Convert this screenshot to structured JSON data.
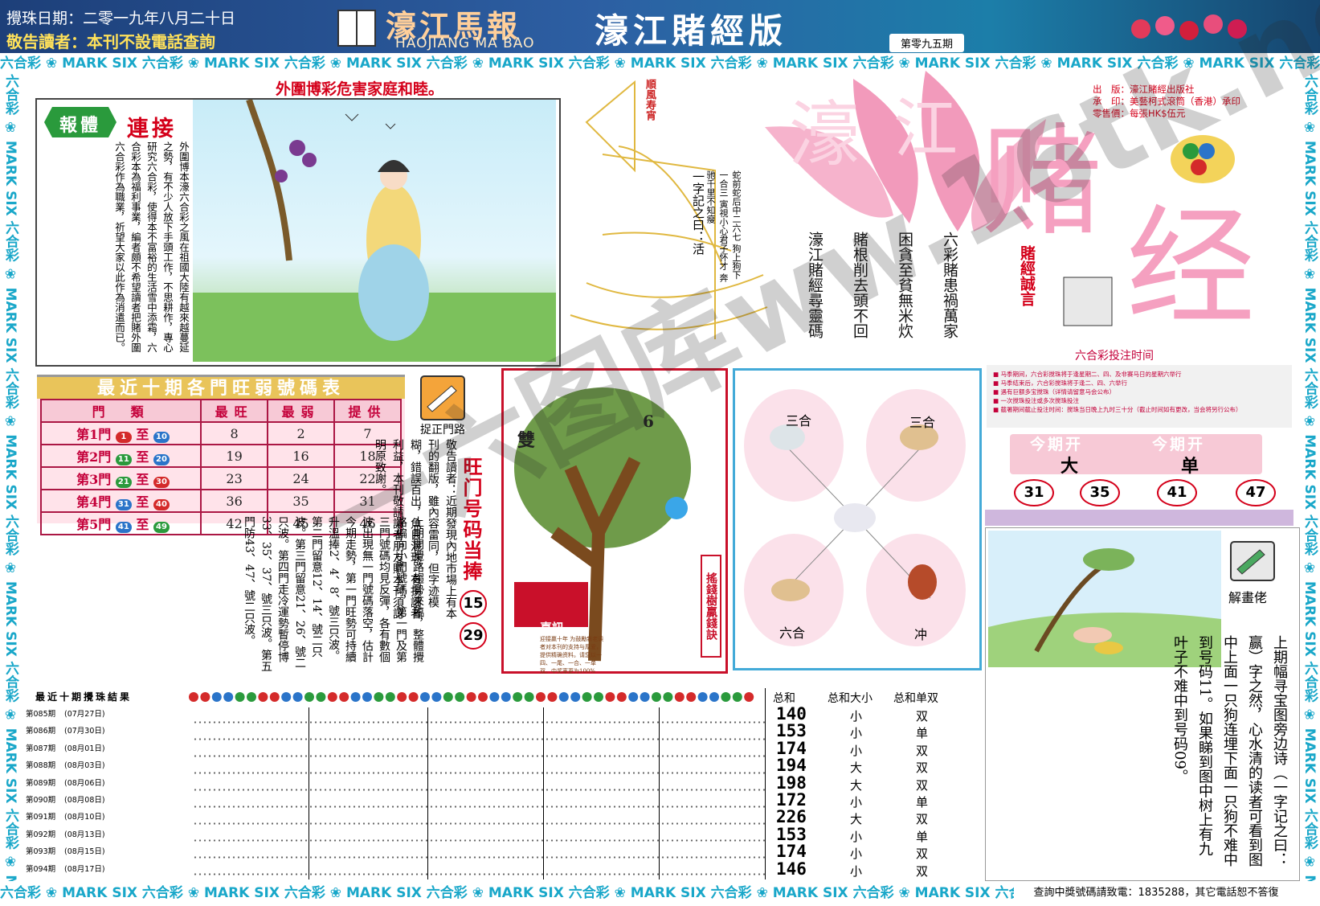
{
  "header": {
    "date_line": "攪珠日期：二零一九年八月二十日",
    "warning": "敬告讀者：本刊不設電話查詢",
    "paper_name": "濠江馬報",
    "paper_roman": "HAOJIANG MA BAO",
    "edition_title": "濠江賭經版",
    "issue": "第零九五期"
  },
  "border_strip": "六合彩 ❀ MARK SIX 六合彩 ❀ MARK SIX 六合彩 ❀ MARK SIX 六合彩 ❀ MARK SIX 六合彩 ❀ MARK SIX 六合彩 ❀ MARK SIX 六合彩 ❀ MARK SIX 六合彩 ❀ MARK SIX 六合彩 ❀ MARK SIX 六合彩 ❀ MARK SIX",
  "hotline": "查詢中獎號碼請致電：1835288，其它電話恕不答復",
  "story": {
    "title": "外圍博彩危害家庭和睦。",
    "badge": "報體",
    "serial": "連接",
    "text": "外圍博本濠六合彩之風在祖國大陸有越來越蔓延之勢，有不少人放下手頭工作，不思耕作，專心研究六合彩，使得本不富裕的生活雪中添霜，六合彩本為福利事業，編者頗不希望讀者把賭外圍六合彩作為職業，祈望大家以此作為消遣而已。"
  },
  "sail": {
    "label": "順風寿宵",
    "couplet_title": "一字記之曰：活",
    "couplet": "蛇前蛇后中二六七 狗上狗下一合三 寅視小心君子怀才 奔驰千里不知瘦"
  },
  "logo": {
    "words": [
      "濠",
      "江",
      "赌",
      "经"
    ],
    "publisher_lines": [
      "出　版：濠江賭經出版社",
      "承　印：美藝柯式滾筒（香港）承印",
      "零售價：每張HK$伍元"
    ],
    "poem": [
      "六彩賭患禍萬家",
      "困貪至貧無米炊",
      "賭根削去頭不回",
      "濠江賭經尋靈碼"
    ],
    "motto": "賭經誠言"
  },
  "hot_table": {
    "title": "最近十期各門旺弱號碼表",
    "headers": [
      "門　類",
      "最旺",
      "最弱",
      "提供"
    ],
    "rows": [
      {
        "door": "第1門",
        "from": "1",
        "to": "10",
        "from_color": "#d42a2a",
        "to_color": "#2a74c9",
        "hot": "8",
        "cold": "2",
        "offer": "7"
      },
      {
        "door": "第2門",
        "from": "11",
        "to": "20",
        "from_color": "#2a9a3c",
        "to_color": "#2a74c9",
        "hot": "19",
        "cold": "16",
        "offer": "18"
      },
      {
        "door": "第3門",
        "from": "21",
        "to": "30",
        "from_color": "#2a9a3c",
        "to_color": "#d42a2a",
        "hot": "23",
        "cold": "24",
        "offer": "22"
      },
      {
        "door": "第4門",
        "from": "31",
        "to": "40",
        "from_color": "#2a74c9",
        "to_color": "#d42a2a",
        "hot": "36",
        "cold": "35",
        "offer": "31"
      },
      {
        "door": "第5門",
        "from": "41",
        "to": "49",
        "from_color": "#2a74c9",
        "to_color": "#2a9a3c",
        "hot": "42",
        "cold": "45",
        "offer": "46"
      }
    ]
  },
  "catch_label": "捉正門路",
  "notice": "敬告讀者：近期發現內地市場上有本刊的翻版，雖內容雷同，但字迹模糊，錯誤百出，魚目混珠。有損讀者利益，本刊敬請讀者朋友購本刊須認明原致謝。",
  "commentary": "上期開攪路趨勢來臨，整體攪路偏向小門號碼，第一門及第三門號碼均見反彈，各有數個波出現無一門號碼落空，估計今期走勢，第一門旺勢可持續升溫捧2、4、8、號三只波。第二門留意12、14、號二只波。第三門留意21、26、號二只波。第四門走冷運勢暫停博33、35、37、號三只波。第五門防43、47、號二只波。",
  "wang": {
    "label": "旺门号码当捧",
    "numbers": [
      "15",
      "29"
    ]
  },
  "tree": {
    "left_label": "雙",
    "right_label": "6",
    "side_label": "搖錢樹贏錢訣",
    "news_title": "喜訊",
    "news_text": "迎接贏十年 为鼓勵新老读者对本刊的支持与厚爱，提供精确资料。请您以一四、一尾、一合、一单双。中奖率更为100%"
  },
  "zodiac": {
    "labels": [
      "三合",
      "三合",
      "六合",
      "冲"
    ]
  },
  "schedule": {
    "title": "六合彩投注时间",
    "lines": [
      "■ 马季期间，六合彩搅珠将于逢星期二、四、及非赛马日的星期六举行",
      "■ 马季结束后，六合彩搅珠将于逢二、四、六举行",
      "■ 遇有巨额多宝搅珠（详情请留意马会公布）",
      "■ 一次搅珠投注或多次搅珠投注",
      "■ 截署期间截止投注时间：搅珠当日晚上九时三十分（截止时间如有更改，当会将另行公布）"
    ],
    "kai": [
      {
        "title": "今期开",
        "value": "大"
      },
      {
        "title": "今期开",
        "value": "单"
      }
    ],
    "numbers": [
      "31",
      "35",
      "41",
      "47"
    ]
  },
  "riddle": {
    "label": "解畫佬",
    "text": "上期幅寻宝图旁边诗（一字记之曰：赢）字之然，心水清的读者可看到图中上面一只狗连埋下面一只狗不难中到号码11。如果睇到图中树上有九叶子不难中到号码09。"
  },
  "results": {
    "title": "最近十期攪珠結果",
    "headers": [
      "总和",
      "总和大小",
      "总和单双"
    ],
    "rows": [
      {
        "period": "第085期",
        "date": "(07月27日)",
        "sum": "140",
        "size": "小",
        "parity": "双"
      },
      {
        "period": "第086期",
        "date": "(07月30日)",
        "sum": "153",
        "size": "小",
        "parity": "单"
      },
      {
        "period": "第087期",
        "date": "(08月01日)",
        "sum": "174",
        "size": "小",
        "parity": "双"
      },
      {
        "period": "第088期",
        "date": "(08月03日)",
        "sum": "194",
        "size": "大",
        "parity": "双"
      },
      {
        "period": "第089期",
        "date": "(08月06日)",
        "sum": "198",
        "size": "大",
        "parity": "双"
      },
      {
        "period": "第090期",
        "date": "(08月08日)",
        "sum": "172",
        "size": "小",
        "parity": "单"
      },
      {
        "period": "第091期",
        "date": "(08月10日)",
        "sum": "226",
        "size": "大",
        "parity": "双"
      },
      {
        "period": "第092期",
        "date": "(08月13日)",
        "sum": "153",
        "size": "小",
        "parity": "单"
      },
      {
        "period": "第093期",
        "date": "(08月15日)",
        "sum": "174",
        "size": "小",
        "parity": "双"
      },
      {
        "period": "第094期",
        "date": "(08月17日)",
        "sum": "146",
        "size": "小",
        "parity": "双"
      }
    ]
  },
  "watermark": "一六图库ww.16tk.net"
}
